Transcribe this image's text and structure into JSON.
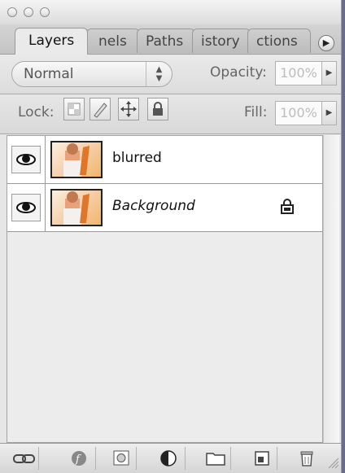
{
  "tabs": [
    {
      "label": "Layers",
      "active": true
    },
    {
      "label": "Channels",
      "visible_text": "nels"
    },
    {
      "label": "Paths",
      "visible_text": "Paths"
    },
    {
      "label": "History",
      "visible_text": "istory"
    },
    {
      "label": "Actions",
      "visible_text": "ctions"
    }
  ],
  "options": {
    "blend_mode": "Normal",
    "opacity_label": "Opacity:",
    "opacity_value": "100%",
    "lock_label": "Lock:",
    "fill_label": "Fill:",
    "fill_value": "100%"
  },
  "layers": [
    {
      "name": "blurred",
      "visible": true,
      "locked": false
    },
    {
      "name": "Background",
      "visible": true,
      "locked": true
    }
  ],
  "toolbar": {
    "icons": [
      "link-layers-icon",
      "layer-style-icon",
      "layer-mask-icon",
      "adjustment-layer-icon",
      "new-group-icon",
      "new-layer-icon",
      "delete-layer-icon"
    ]
  }
}
